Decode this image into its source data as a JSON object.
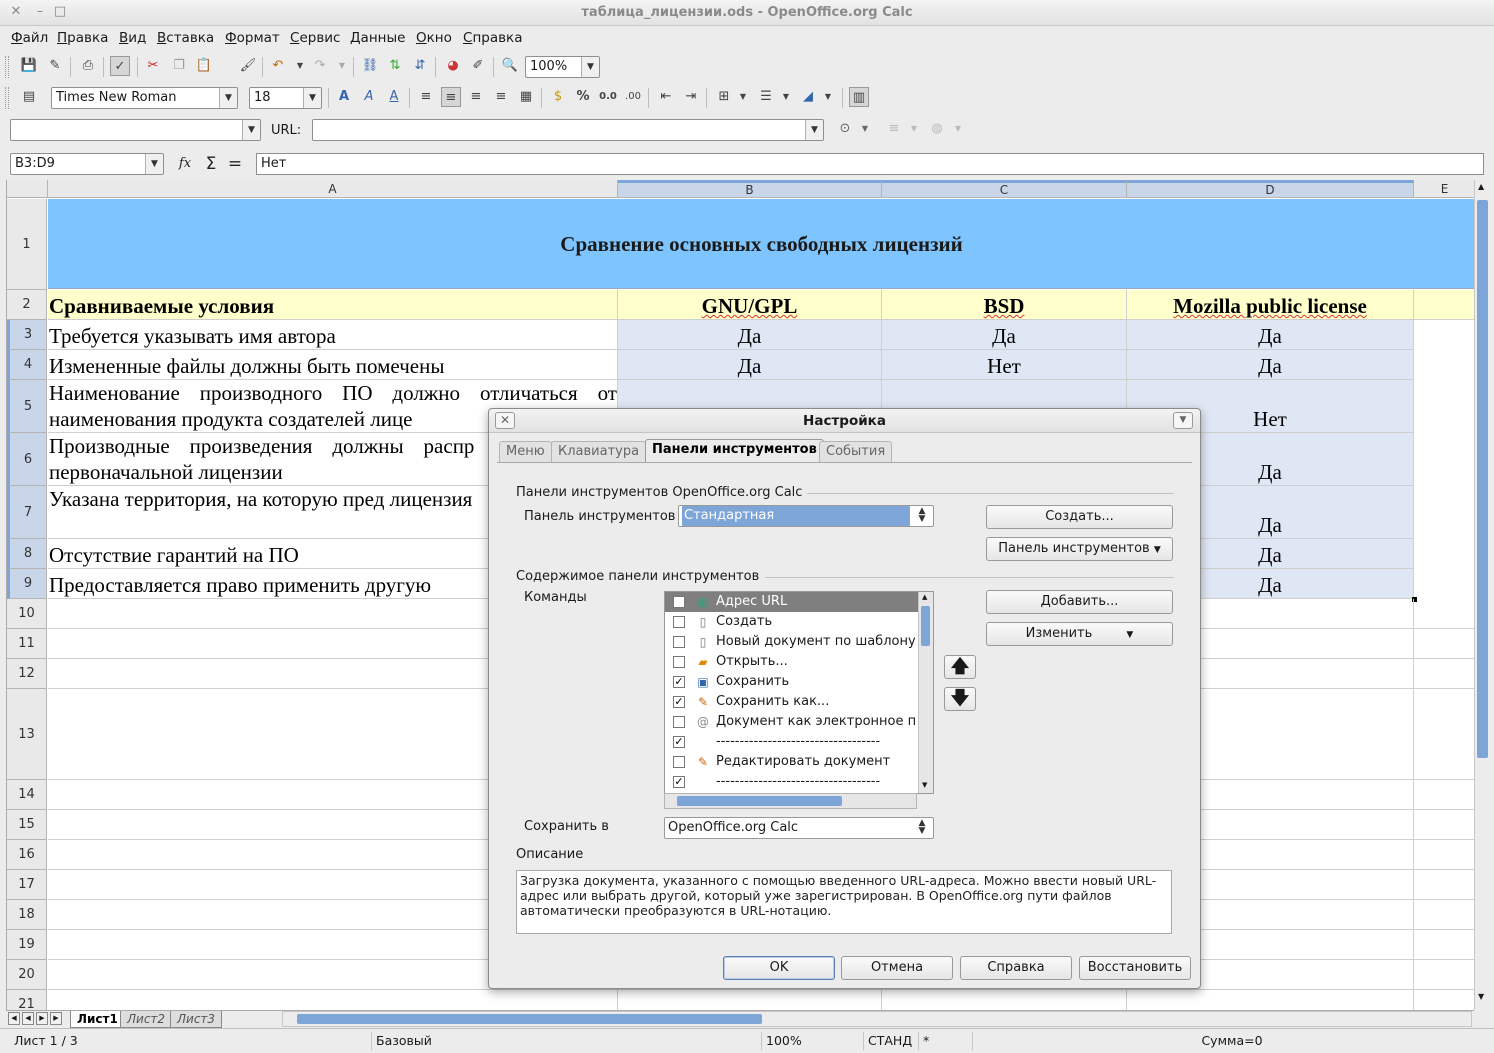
{
  "window": {
    "title": "таблица_лицензии.ods - OpenOffice.org Calc"
  },
  "menu": [
    "Файл",
    "Правка",
    "Вид",
    "Вставка",
    "Формат",
    "Сервис",
    "Данные",
    "Окно",
    "Справка"
  ],
  "standard_toolbar": {
    "zoom": "100%"
  },
  "format_toolbar": {
    "font_name": "Times New Roman",
    "font_size": "18"
  },
  "forms_toolbar": {
    "url_label": "URL:",
    "url_value": ""
  },
  "formula_bar": {
    "name_box": "B3:D9",
    "content": "Нет"
  },
  "columns": [
    "A",
    "B",
    "C",
    "D",
    "E"
  ],
  "rows": [
    "1",
    "2",
    "3",
    "4",
    "5",
    "6",
    "7",
    "8",
    "9",
    "10",
    "11",
    "12",
    "13",
    "14",
    "15",
    "16",
    "17",
    "18",
    "19",
    "20",
    "21"
  ],
  "sheet": {
    "title": "Сравнение  основных свободных лицензий",
    "header": [
      "Сравниваемые условия",
      "GNU/GPL",
      "BSD",
      "Mozilla public license"
    ],
    "r3": [
      "Требуется указывать имя автора",
      "Да",
      "Да",
      "Да"
    ],
    "r4": [
      "Измененные файлы должны быть помечены",
      "Да",
      "Нет",
      "Да"
    ],
    "r5": [
      "Наименование производного ПО должно отличаться от наименования продукта создателей лице",
      "",
      "",
      "Нет"
    ],
    "r6": [
      "Производные произведения должны распр на условиях первоначальной лицензии",
      "",
      "",
      "Да"
    ],
    "r7": [
      "Указана территория, на которую пред лицензия",
      "",
      "",
      "Да"
    ],
    "r8": [
      "Отсутствие гарантий на ПО",
      "",
      "",
      "Да"
    ],
    "r9": [
      "Предоставляется право применить другую",
      "",
      "",
      "Да"
    ]
  },
  "sheet_tabs": [
    "Лист1",
    "Лист2",
    "Лист3"
  ],
  "status": {
    "sheet": "Лист 1 / 3",
    "style": "Базовый",
    "zoom": "100%",
    "mode": "СТАНД",
    "modified": "*",
    "sum": "Сумма=0"
  },
  "dialog": {
    "title": "Настройка",
    "tabs": [
      "Меню",
      "Клавиатура",
      "Панели инструментов",
      "События"
    ],
    "group1": "Панели инструментов OpenOffice.org Calc",
    "toolbar_label": "Панель инструментов",
    "toolbar_value": "Стандартная",
    "create_btn": "Создать...",
    "toolbar_menu_btn": "Панель инструментов",
    "group2": "Содержимое панели инструментов",
    "commands_label": "Команды",
    "commands": [
      {
        "label": "Адрес URL",
        "checked": false,
        "icon": "globe-icon"
      },
      {
        "label": "Создать",
        "checked": false,
        "icon": "new-doc-icon"
      },
      {
        "label": "Новый документ по шаблону",
        "checked": false,
        "icon": "template-icon"
      },
      {
        "label": "Открыть...",
        "checked": false,
        "icon": "open-folder-icon"
      },
      {
        "label": "Сохранить",
        "checked": true,
        "icon": "save-icon"
      },
      {
        "label": "Сохранить как...",
        "checked": true,
        "icon": "save-as-icon"
      },
      {
        "label": "Документ как электронное п",
        "checked": false,
        "icon": "email-icon"
      },
      {
        "label": "-----------------------------------",
        "checked": true,
        "icon": ""
      },
      {
        "label": "Редактировать документ",
        "checked": false,
        "icon": "edit-icon"
      },
      {
        "label": "-----------------------------------",
        "checked": true,
        "icon": ""
      }
    ],
    "add_btn": "Добавить...",
    "modify_btn": "Изменить",
    "save_in_label": "Сохранить в",
    "save_in_value": "OpenOffice.org Calc",
    "description_label": "Описание",
    "description": "Загрузка документа, указанного с помощью введенного URL-адреса. Можно ввести новый URL-адрес или выбрать другой, который уже зарегистрирован. В OpenOffice.org пути файлов автоматически преобразуются в URL-нотацию.",
    "ok_btn": "OK",
    "cancel_btn": "Отмена",
    "help_btn": "Справка",
    "reset_btn": "Восстановить"
  }
}
